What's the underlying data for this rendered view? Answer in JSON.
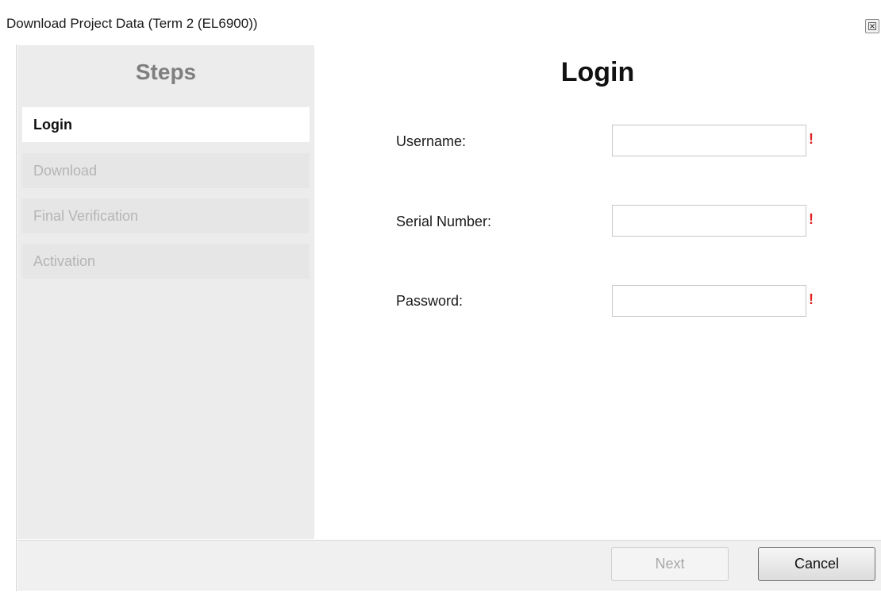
{
  "window": {
    "title": "Download Project Data (Term 2 (EL6900))",
    "close_icon": "close-icon"
  },
  "steps": {
    "title": "Steps",
    "items": [
      {
        "label": "Login",
        "state": "active"
      },
      {
        "label": "Download",
        "state": "disabled"
      },
      {
        "label": "Final Verification",
        "state": "disabled"
      },
      {
        "label": "Activation",
        "state": "disabled"
      }
    ]
  },
  "content": {
    "title": "Login",
    "fields": [
      {
        "label": "Username:",
        "value": "",
        "required_mark": "!"
      },
      {
        "label": "Serial Number:",
        "value": "",
        "required_mark": "!"
      },
      {
        "label": "Password:",
        "value": "",
        "required_mark": "!"
      }
    ]
  },
  "footer": {
    "next_label": "Next",
    "cancel_label": "Cancel"
  },
  "colors": {
    "required": "#e02020",
    "panel_bg": "#ececec",
    "disabled_text": "#b5b5b5"
  }
}
